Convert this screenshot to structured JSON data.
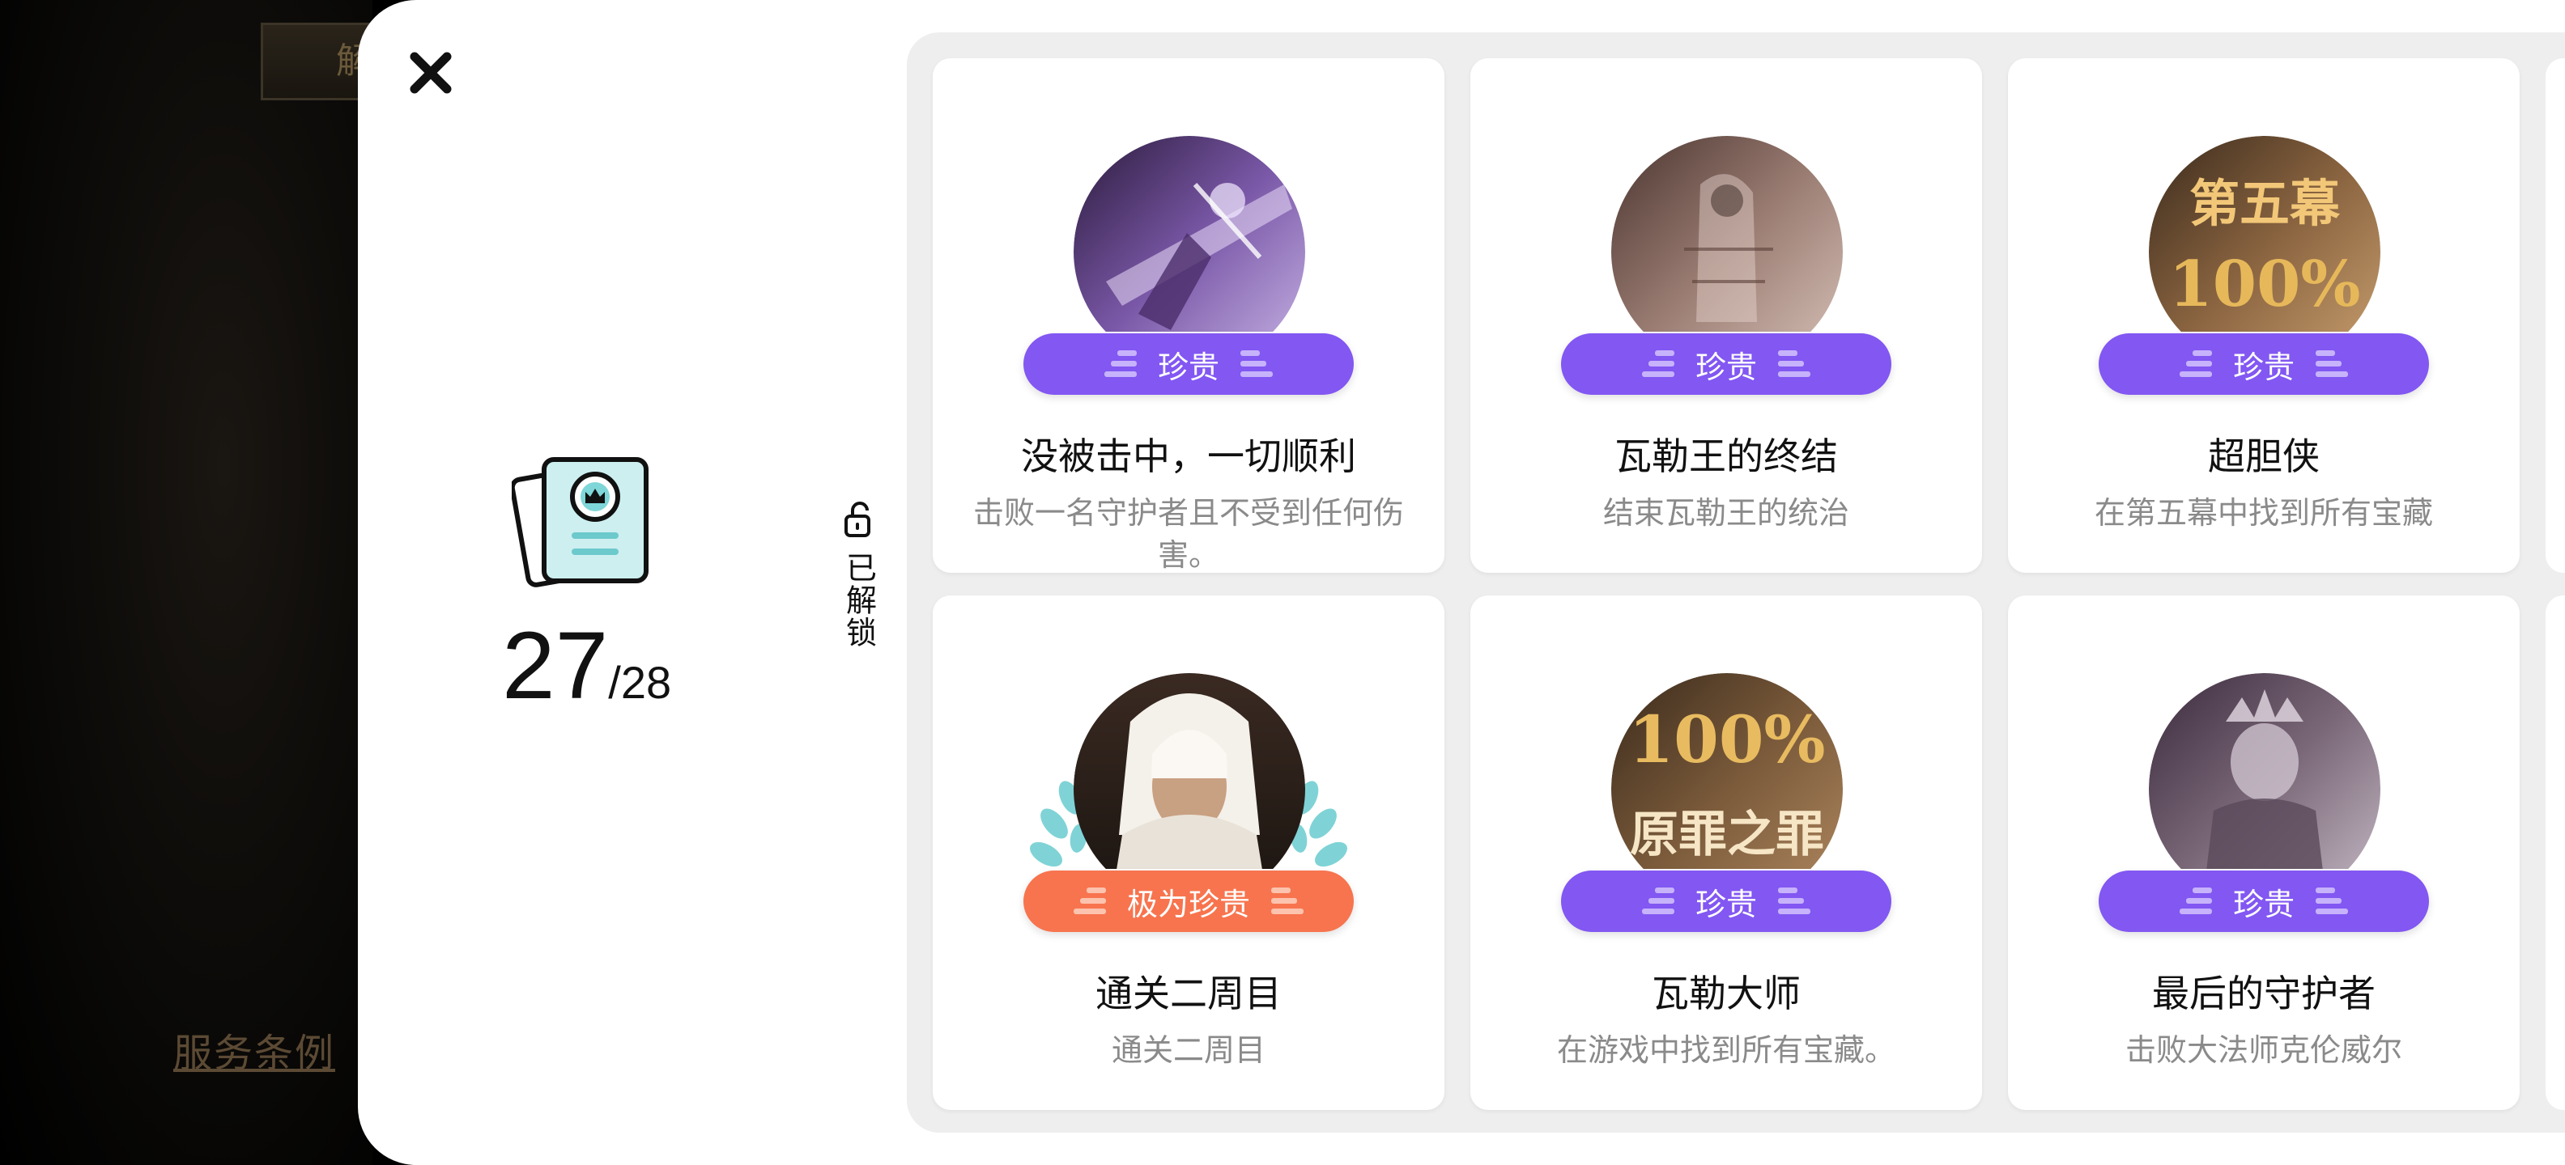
{
  "background": {
    "top_button_label": "解",
    "terms_link": "服务条例"
  },
  "panel": {
    "close_icon": "close-icon",
    "summary": {
      "unlocked": "27",
      "total": "/28"
    },
    "unlock_tab_label": "已解锁"
  },
  "achievements": [
    {
      "medal_text": "",
      "rarity": "珍贵",
      "title": "没被击中，一切顺利",
      "desc": "击败一名守护者且不受到任何伤害。"
    },
    {
      "medal_text": "",
      "rarity": "珍贵",
      "title": "瓦勒王的终结",
      "desc": "结束瓦勒王的统治"
    },
    {
      "medal_text": "第五幕",
      "medal_text2": "100%",
      "rarity": "珍贵",
      "title": "超胆侠",
      "desc": "在第五幕中找到所有宝藏"
    },
    {
      "medal_text": "",
      "rarity": "极为珍贵",
      "title": "通关二周目",
      "desc": "通关二周目"
    },
    {
      "medal_text": "100%",
      "medal_text2": "原罪之罪",
      "rarity": "珍贵",
      "title": "瓦勒大师",
      "desc": "在游戏中找到所有宝藏。"
    },
    {
      "medal_text": "",
      "rarity": "珍贵",
      "title": "最后的守护者",
      "desc": "击败大法师克伦威尔"
    }
  ],
  "colors": {
    "rare_purple": "#8257f2",
    "very_rare_orange": "#f7744e"
  }
}
